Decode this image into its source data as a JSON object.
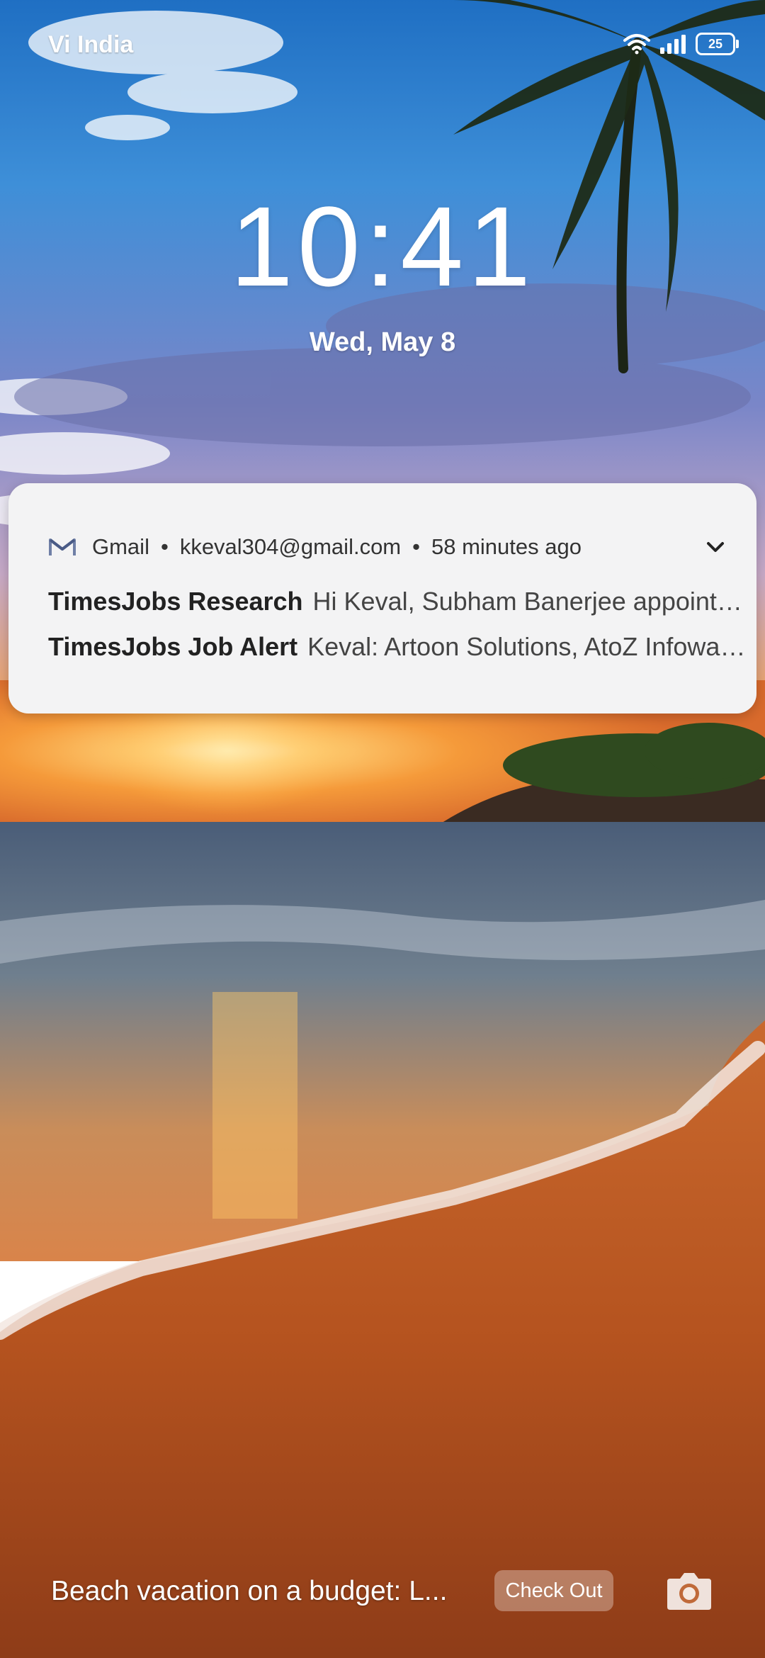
{
  "status_bar": {
    "carrier": "Vi India",
    "battery_level": "25",
    "icons": [
      "wifi-icon",
      "signal-icon",
      "battery-icon"
    ]
  },
  "lockscreen": {
    "time": "10:41",
    "date": "Wed, May 8"
  },
  "notification": {
    "app_name": "Gmail",
    "account": "kkeval304@gmail.com",
    "time_ago": "58 minutes ago",
    "separator": "•",
    "icon": "gmail-icon",
    "messages": [
      {
        "sender": "TimesJobs Research",
        "preview": "Hi Keval, Subham Banerjee appointed as Head Reporting and Analytics at Bajaj Finance"
      },
      {
        "sender": "TimesJobs Job Alert",
        "preview": "Keval: Artoon Solutions, AtoZ Infoway and others are hiring"
      }
    ]
  },
  "footer": {
    "promo_text": "Beach vacation on a budget: L...",
    "cta_label": "Check Out",
    "camera_icon": "camera-icon"
  },
  "colors": {
    "sky_top": "#2d7fd0",
    "sunset": "#f39a2e",
    "sand": "#b8561f",
    "card_bg": "#f3f3f4"
  }
}
